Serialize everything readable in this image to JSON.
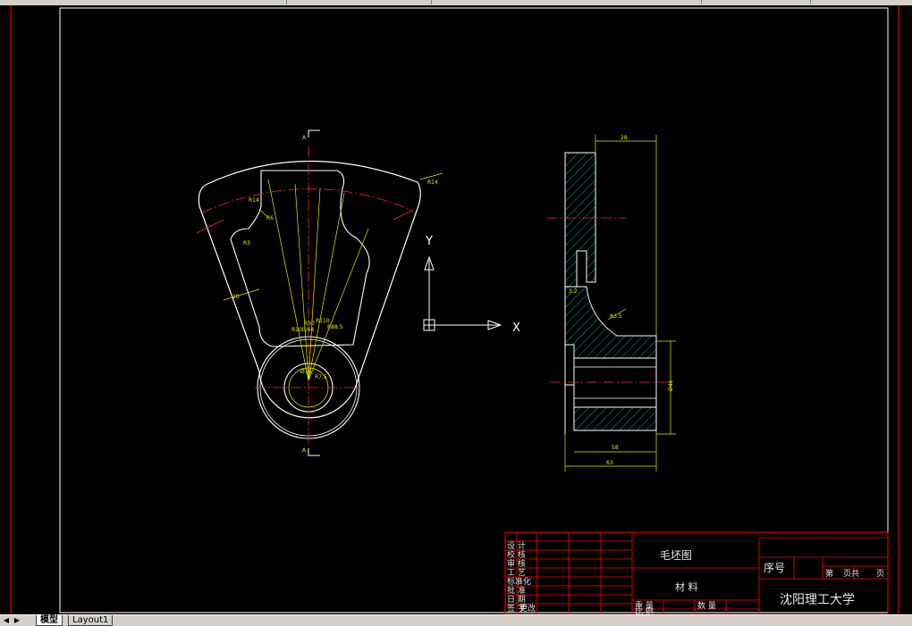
{
  "titleblock": {
    "drawing_name": "毛坯图",
    "material_label": "材    料",
    "sequence_label": "序号",
    "university": "沈阳理工大学",
    "sheet_label_1": "第",
    "sheet_label_2": "页共",
    "sheet_label_3": "页",
    "weight_label": "重  量",
    "scale_label": "比  例",
    "count_label": "数  量",
    "left_column": [
      "设 计",
      "校 核",
      "审 核",
      "工 艺",
      "标准化",
      "批 准",
      "日 期",
      "签 字",
      "更改"
    ]
  },
  "axes": {
    "y_label": "Y",
    "x_label": "X"
  },
  "section_marks": {
    "top": "A",
    "bottom": "A"
  },
  "dimensions": {
    "side_top": "28",
    "side_bottom_inner": "58",
    "side_bottom_outer": "63",
    "side_height": "Ø46",
    "side_radius": "R3.5",
    "side_left": "3.2",
    "front_r14": "R14",
    "front_r6": "R6",
    "front_r3": "R3",
    "front_r14b": "R14",
    "front_r10": "R10",
    "front_rad1": "R90",
    "front_rad2": "R110",
    "front_rad3": "R100/64",
    "front_rad4": "R88.5",
    "front_d1": "Ø16",
    "front_d2": "R7.5",
    "front_20": "20"
  },
  "tabs": {
    "model": "模型",
    "layout1": "Layout1"
  },
  "colors": {
    "outline": "#ffffff",
    "center": "#ff2020",
    "dimension": "#e8e800",
    "hatch": "#00c8c8",
    "border": "#ff0000"
  }
}
